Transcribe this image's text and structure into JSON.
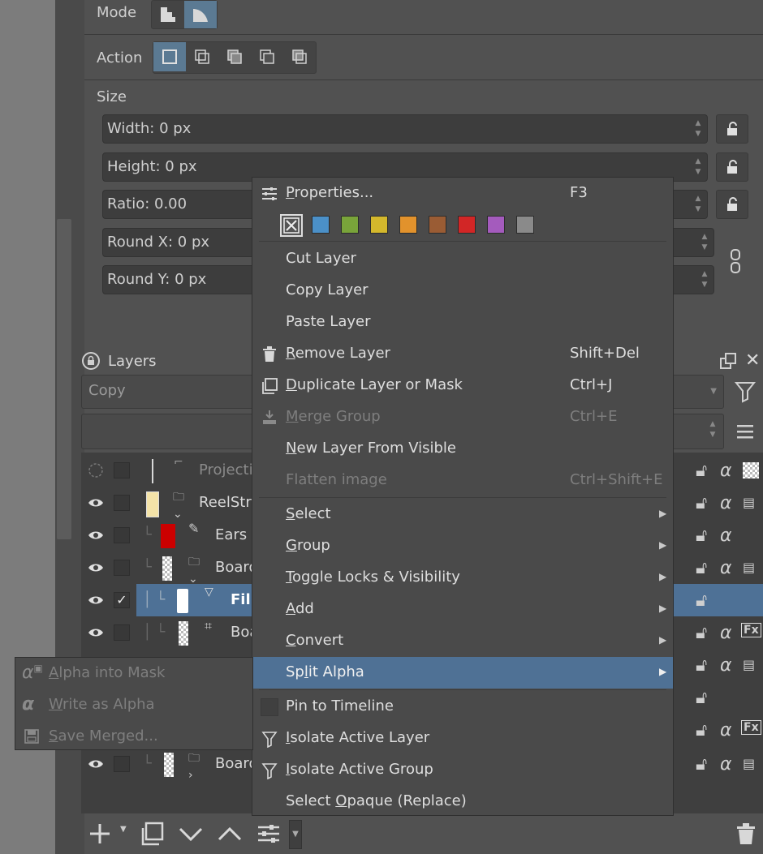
{
  "tool_options": {
    "mode_label": "Mode",
    "action_label": "Action",
    "size_label": "Size",
    "fields": [
      {
        "label": "Width: 0 px"
      },
      {
        "label": "Height: 0 px"
      },
      {
        "label": "Ratio: 0.00"
      },
      {
        "label": "Round X: 0 px"
      },
      {
        "label": "Round Y: 0 px"
      }
    ]
  },
  "layers_panel": {
    "title": "Layers",
    "blend_mode": "Copy",
    "layers": [
      {
        "name": "Projecti",
        "dim": true
      },
      {
        "name": "ReelStri"
      },
      {
        "name": "Ears"
      },
      {
        "name": "Board"
      },
      {
        "name": "Fill",
        "selected": true,
        "checked": true,
        "checkmark": "✓"
      },
      {
        "name": "Boa"
      },
      {
        "name": "Board"
      }
    ]
  },
  "context_menu": {
    "items": [
      {
        "id": "properties",
        "prefix": "",
        "accel": "P",
        "rest": "roperties...",
        "shortcut": "F3"
      },
      {
        "id": "cut-layer",
        "prefix": "Cut Layer",
        "accel": "",
        "rest": ""
      },
      {
        "id": "copy-layer",
        "prefix": "Copy Layer",
        "accel": "",
        "rest": ""
      },
      {
        "id": "paste-layer",
        "prefix": "Paste Layer",
        "accel": "",
        "rest": ""
      },
      {
        "id": "remove-layer",
        "prefix": "",
        "accel": "R",
        "rest": "emove Layer",
        "shortcut": "Shift+Del"
      },
      {
        "id": "duplicate-layer",
        "prefix": "",
        "accel": "D",
        "rest": "uplicate Layer or Mask",
        "shortcut": "Ctrl+J"
      },
      {
        "id": "merge-group",
        "prefix": "",
        "accel": "M",
        "rest": "erge Group",
        "shortcut": "Ctrl+E"
      },
      {
        "id": "new-layer-from-visible",
        "prefix": "",
        "accel": "N",
        "rest": "ew Layer From Visible"
      },
      {
        "id": "flatten-image",
        "prefix": "Flatten ima",
        "accel": "g",
        "rest": "e",
        "shortcut": "Ctrl+Shift+E"
      },
      {
        "id": "select",
        "prefix": "",
        "accel": "S",
        "rest": "elect"
      },
      {
        "id": "group",
        "prefix": "",
        "accel": "G",
        "rest": "roup"
      },
      {
        "id": "toggle-locks",
        "prefix": "",
        "accel": "T",
        "rest": "oggle Locks & Visibility"
      },
      {
        "id": "add",
        "prefix": "",
        "accel": "A",
        "rest": "dd"
      },
      {
        "id": "convert",
        "prefix": "",
        "accel": "C",
        "rest": "onvert"
      },
      {
        "id": "split-alpha",
        "prefix": "Sp",
        "accel": "l",
        "rest": "it Alpha"
      },
      {
        "id": "pin-to-timeline",
        "prefix": "Pin to Timeline",
        "accel": "",
        "rest": ""
      },
      {
        "id": "isolate-active-layer",
        "prefix": "",
        "accel": "I",
        "rest": "solate Active Layer"
      },
      {
        "id": "isolate-active-group",
        "prefix": "",
        "accel": "I",
        "rest": "solate Active Group"
      },
      {
        "id": "select-opaque",
        "prefix": "Select ",
        "accel": "O",
        "rest": "paque (Replace)"
      }
    ],
    "color_labels": [
      "#4b90c8",
      "#79a43a",
      "#d4b82c",
      "#e2922c",
      "#9a5c34",
      "#d22626",
      "#a45bbd",
      "#8a8a8a"
    ]
  },
  "split_alpha_submenu": {
    "items": [
      {
        "id": "alpha-into-mask",
        "accel": "A",
        "rest": "lpha into Mask"
      },
      {
        "id": "write-as-alpha",
        "accel": "W",
        "rest": "rite as Alpha"
      },
      {
        "id": "save-merged",
        "accel": "S",
        "rest": "ave Merged..."
      }
    ]
  },
  "colors": {
    "highlight": "#4f7195",
    "selected_row": "#4e7196",
    "active_tool": "#5b7a93"
  }
}
